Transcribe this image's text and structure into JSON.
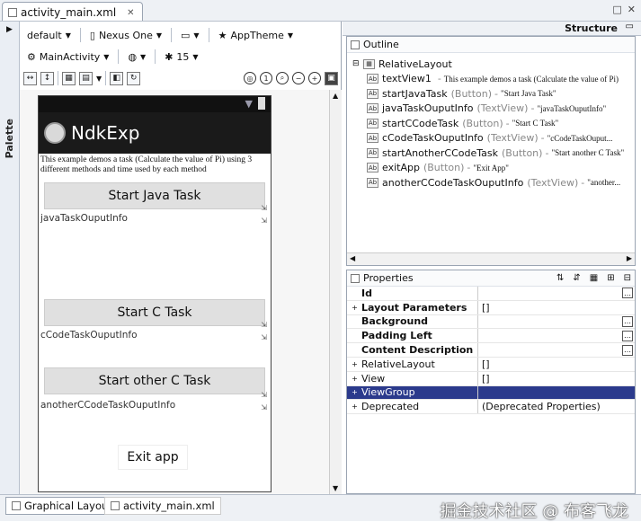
{
  "editor_tab": {
    "title": "activity_main.xml",
    "close": "✕"
  },
  "window": {
    "restore": "□",
    "close": "✕"
  },
  "palette": {
    "label": "Palette"
  },
  "toolbar1": {
    "config": "default",
    "device": "Nexus One",
    "theme": "AppTheme"
  },
  "toolbar2": {
    "activity": "MainActivity",
    "api": "15"
  },
  "preview": {
    "app_title": "NdkExp",
    "description": "This example demos a task (Calculate the value of Pi) using 3 different methods and time used by each method",
    "btn_java": "Start Java Task",
    "tv_java": "javaTaskOuputInfo",
    "btn_c": "Start C Task",
    "tv_c": "cCodeTaskOuputInfo",
    "btn_other": "Start other C Task",
    "tv_other": "anotherCCodeTaskOuputInfo",
    "btn_exit": "Exit app"
  },
  "structure": {
    "title": "Structure"
  },
  "outline": {
    "title": "Outline",
    "root": "RelativeLayout",
    "items": [
      {
        "id": "textView1",
        "type": "",
        "text": "This example demos a task (Calculate the value of Pi)"
      },
      {
        "id": "startJavaTask",
        "type": "(Button)",
        "text": "\"Start Java Task\""
      },
      {
        "id": "javaTaskOuputInfo",
        "type": "(TextView)",
        "text": "\"javaTaskOuputInfo\""
      },
      {
        "id": "startCCodeTask",
        "type": "(Button)",
        "text": "\"Start C Task\""
      },
      {
        "id": "cCodeTaskOuputInfo",
        "type": "(TextView)",
        "text": "\"cCodeTaskOuput..."
      },
      {
        "id": "startAnotherCCodeTask",
        "type": "(Button)",
        "text": "\"Start another C Task\""
      },
      {
        "id": "exitApp",
        "type": "(Button)",
        "text": "\"Exit App\""
      },
      {
        "id": "anotherCCodeTaskOuputInfo",
        "type": "(TextView)",
        "text": "\"another..."
      }
    ]
  },
  "properties": {
    "title": "Properties",
    "rows": [
      {
        "key": "Id",
        "value": "",
        "bold": true,
        "exp": "",
        "dots": true
      },
      {
        "key": "Layout Parameters",
        "value": "[]",
        "bold": true,
        "exp": "+",
        "dots": false
      },
      {
        "key": "Background",
        "value": "",
        "bold": true,
        "exp": "",
        "dots": true
      },
      {
        "key": "Padding Left",
        "value": "",
        "bold": true,
        "exp": "",
        "dots": true
      },
      {
        "key": "Content Description",
        "value": "",
        "bold": true,
        "exp": "",
        "dots": true
      },
      {
        "key": "RelativeLayout",
        "value": "[]",
        "bold": false,
        "exp": "+",
        "dots": false
      },
      {
        "key": "View",
        "value": "[]",
        "bold": false,
        "exp": "+",
        "dots": false
      },
      {
        "key": "ViewGroup",
        "value": "",
        "bold": false,
        "exp": "+",
        "dots": false
      },
      {
        "key": "Deprecated",
        "value": "(Deprecated Properties)",
        "bold": false,
        "exp": "+",
        "dots": false
      }
    ]
  },
  "bottom_tabs": {
    "graphical": "Graphical Layout",
    "xml": "activity_main.xml"
  },
  "watermark": "掘金技术社区 @ 布客飞龙"
}
